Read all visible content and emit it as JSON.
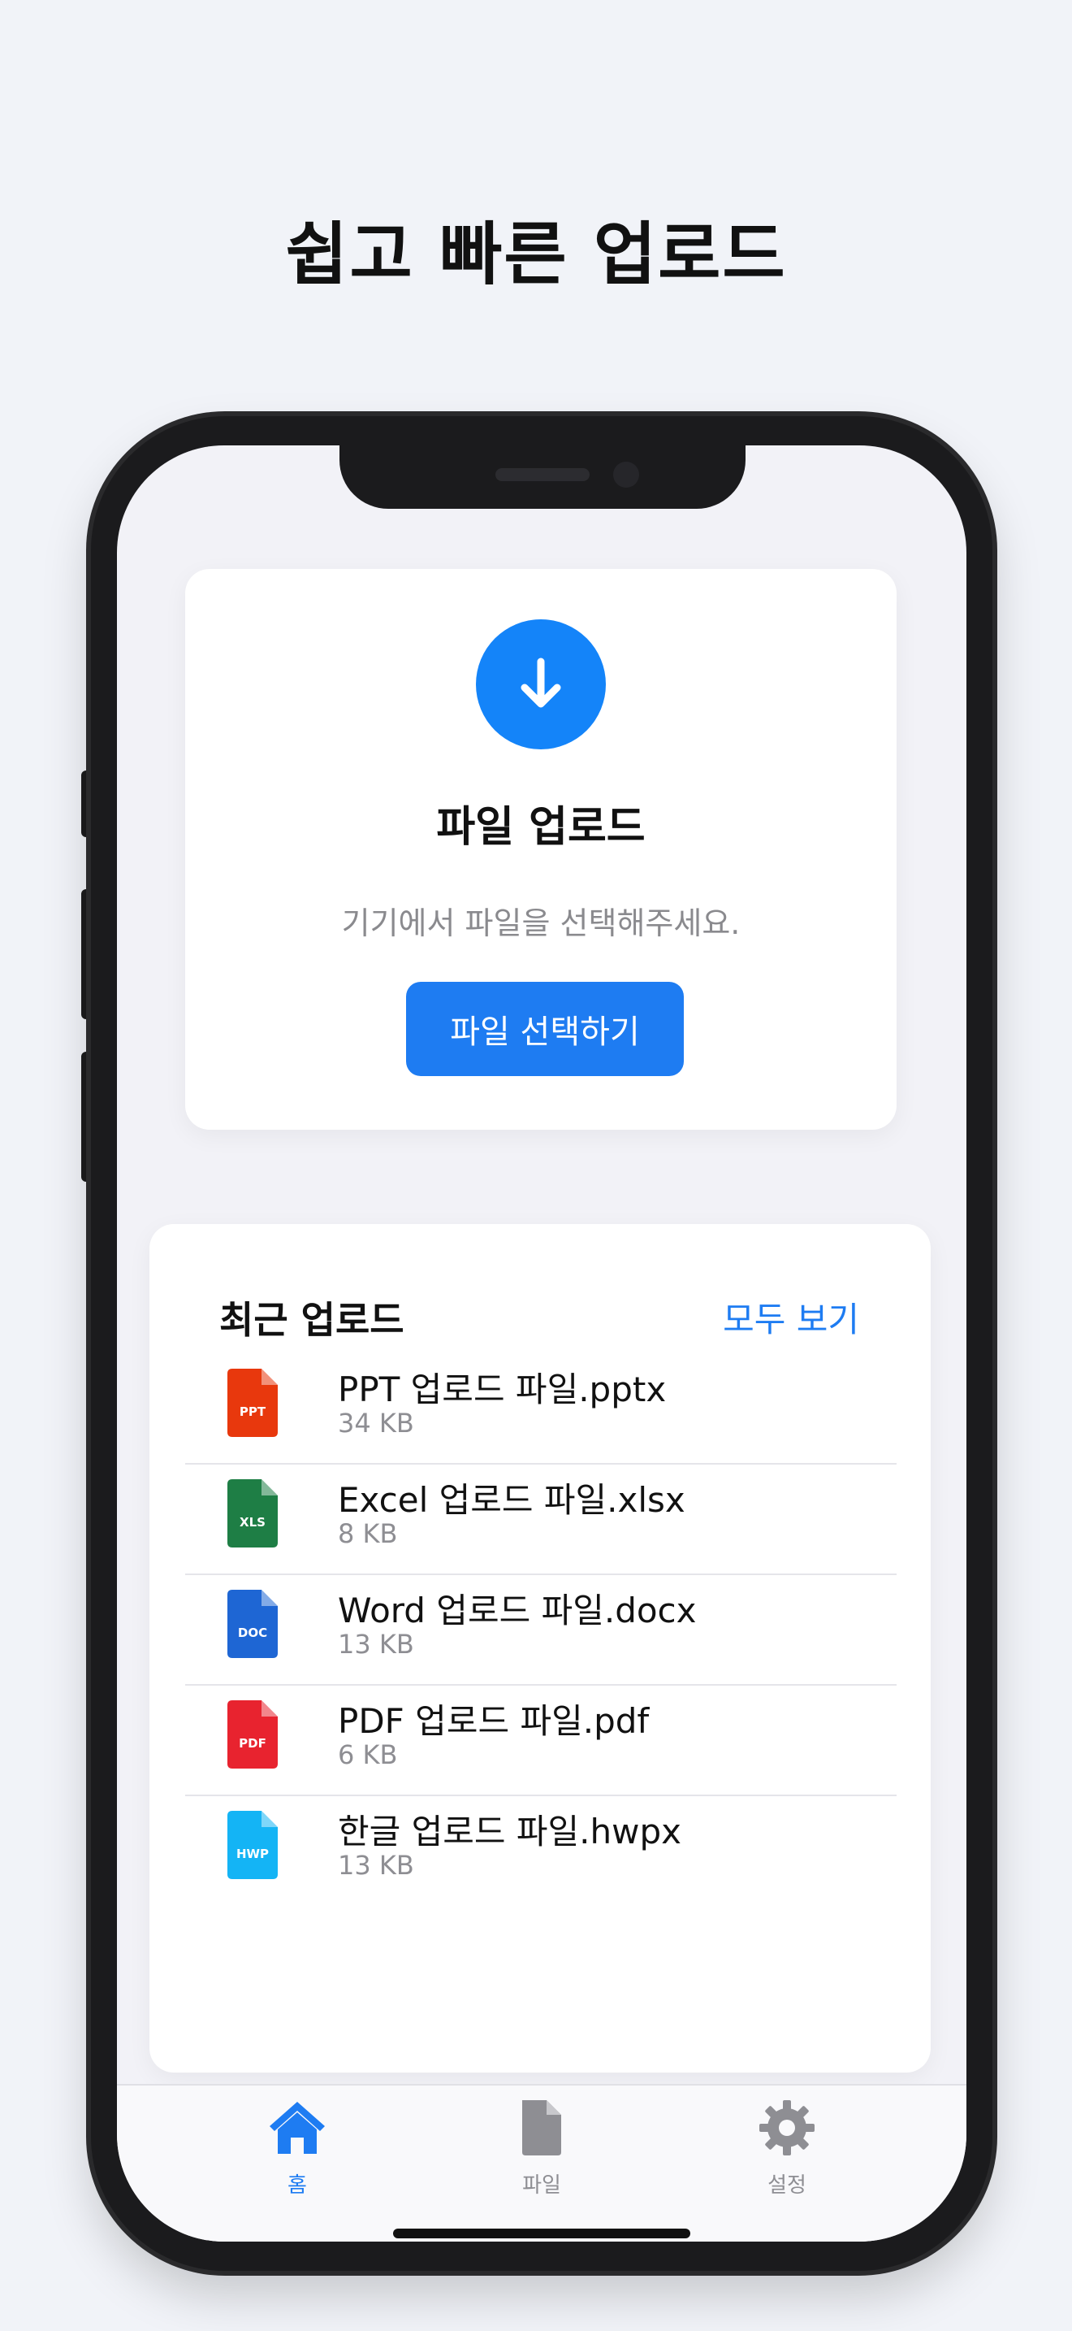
{
  "headline": "쉽고 빠른 업로드",
  "upload": {
    "title": "파일 업로드",
    "description": "기기에서 파일을 선택해주세요.",
    "button_label": "파일 선택하기"
  },
  "recent": {
    "title": "최근 업로드",
    "view_all": "모두 보기",
    "files": [
      {
        "name": "PPT 업로드 파일.pptx",
        "size": "34 KB",
        "badge": "PPT",
        "color": "#E8380D"
      },
      {
        "name": "Excel 업로드 파일.xlsx",
        "size": "8 KB",
        "badge": "XLS",
        "color": "#1E7E45"
      },
      {
        "name": "Word 업로드 파일.docx",
        "size": "13 KB",
        "badge": "DOC",
        "color": "#1E66D4"
      },
      {
        "name": "PDF 업로드 파일.pdf",
        "size": "6 KB",
        "badge": "PDF",
        "color": "#E8232F"
      },
      {
        "name": "한글 업로드 파일.hwpx",
        "size": "13 KB",
        "badge": "HWP",
        "color": "#14B4F5"
      }
    ]
  },
  "tabs": [
    {
      "label": "홈",
      "icon": "house-icon",
      "active": true
    },
    {
      "label": "파일",
      "icon": "document-icon",
      "active": false
    },
    {
      "label": "설정",
      "icon": "gear-icon",
      "active": false
    }
  ],
  "colors": {
    "accent": "#1E7CF2",
    "background": "#F1F3F8",
    "tab_inactive": "#8E8E93"
  }
}
